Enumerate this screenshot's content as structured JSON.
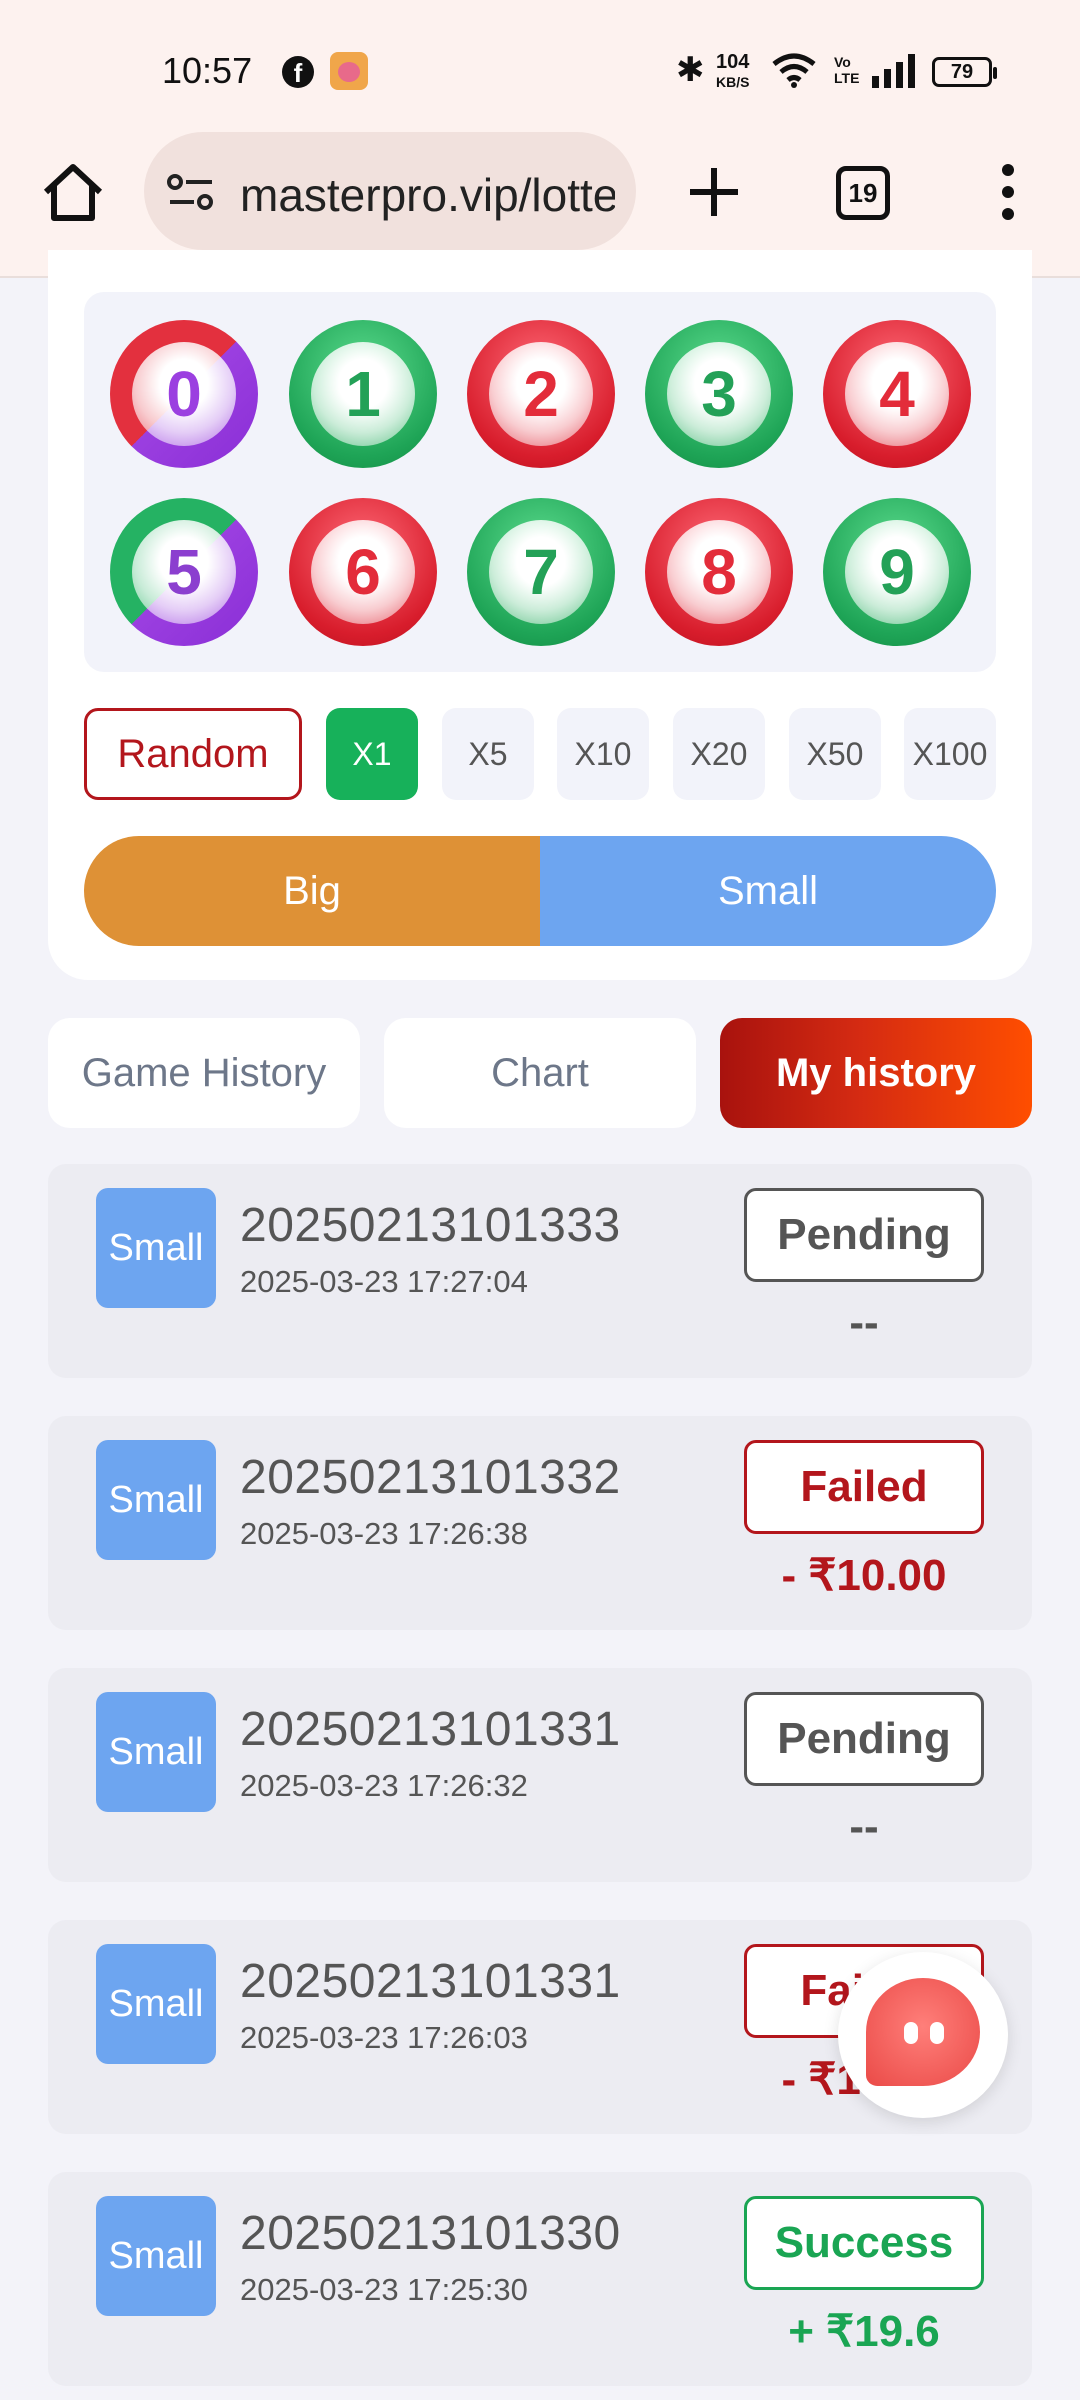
{
  "status_bar": {
    "time": "10:57",
    "net_speed_value": "104",
    "net_speed_unit": "KB/S",
    "volte": "Vo LTE",
    "battery": "79"
  },
  "browser": {
    "url": "masterpro.vip/lottery",
    "tab_count": "19"
  },
  "balls": [
    {
      "number": "0",
      "color": "red-violet"
    },
    {
      "number": "1",
      "color": "green"
    },
    {
      "number": "2",
      "color": "red"
    },
    {
      "number": "3",
      "color": "green"
    },
    {
      "number": "4",
      "color": "red"
    },
    {
      "number": "5",
      "color": "green-violet"
    },
    {
      "number": "6",
      "color": "red"
    },
    {
      "number": "7",
      "color": "green"
    },
    {
      "number": "8",
      "color": "red"
    },
    {
      "number": "9",
      "color": "green"
    }
  ],
  "controls": {
    "random_label": "Random",
    "multipliers": [
      "X1",
      "X5",
      "X10",
      "X20",
      "X50",
      "X100"
    ],
    "selected_multiplier": "X1",
    "big_label": "Big",
    "small_label": "Small"
  },
  "tabs": [
    {
      "label": "Game History",
      "active": false
    },
    {
      "label": "Chart",
      "active": false
    },
    {
      "label": "My history",
      "active": true
    }
  ],
  "history": [
    {
      "type": "Small",
      "period": "20250213101333",
      "time": "2025-03-23 17:27:04",
      "status": "Pending",
      "amount": "--"
    },
    {
      "type": "Small",
      "period": "20250213101332",
      "time": "2025-03-23 17:26:38",
      "status": "Failed",
      "amount": "- ₹10.00"
    },
    {
      "type": "Small",
      "period": "20250213101331",
      "time": "2025-03-23 17:26:32",
      "status": "Pending",
      "amount": "--"
    },
    {
      "type": "Small",
      "period": "20250213101331",
      "time": "2025-03-23 17:26:03",
      "status": "Failed",
      "amount": "- ₹10.00"
    },
    {
      "type": "Small",
      "period": "20250213101330",
      "time": "2025-03-23 17:25:30",
      "status": "Success",
      "amount": "+ ₹19.6"
    }
  ],
  "colors": {
    "red": "#d81d2c",
    "green": "#1ea456",
    "violet": "#8a2ed6",
    "big": "#de9136",
    "small": "#6da5f0",
    "active_tab": "#d52b12",
    "multiplier_active": "#17b15a"
  }
}
